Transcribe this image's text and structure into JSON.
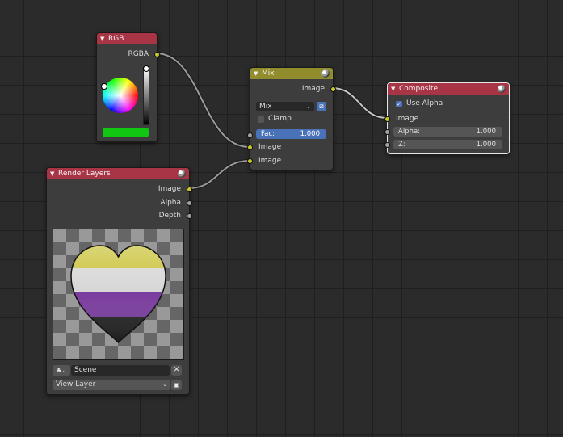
{
  "colors": {
    "node_header_red": "#a83546",
    "node_header_olive": "#918c2c",
    "socket_yellow": "#c7c729",
    "socket_gray": "#a1a1a1",
    "field_blue": "#4a72b8",
    "rgb_swatch": "#12c712",
    "flag": [
      "#c8c032",
      "#d6d6d6",
      "#7a3c9e",
      "#222222"
    ]
  },
  "rgb_node": {
    "title": "RGB",
    "output": "RGBA"
  },
  "mix_node": {
    "title": "Mix",
    "output": "Image",
    "blend_mode": "Mix",
    "clamp_label": "Clamp",
    "fac_label": "Fac:",
    "fac_value": "1.000",
    "input_1": "Image",
    "input_2": "Image"
  },
  "composite_node": {
    "title": "Composite",
    "use_alpha_label": "Use Alpha",
    "use_alpha_checked": true,
    "input_image": "Image",
    "alpha_label": "Alpha:",
    "alpha_value": "1.000",
    "z_label": "Z:",
    "z_value": "1.000"
  },
  "render_layers_node": {
    "title": "Render Layers",
    "outputs": [
      "Image",
      "Alpha",
      "Depth"
    ],
    "scene": "Scene",
    "view_layer": "View Layer"
  }
}
